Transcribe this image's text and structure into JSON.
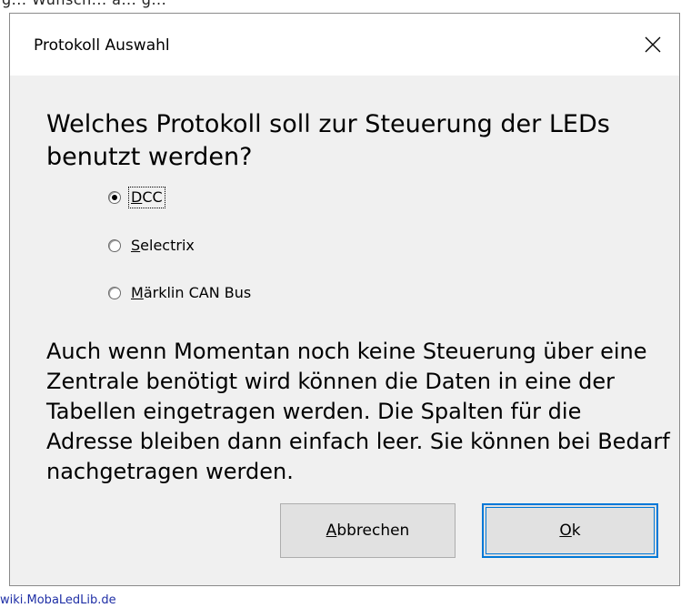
{
  "background": {
    "top_text": "g... Wunsch... a... g...",
    "bottom_link": "wiki.MobaLedLib.de"
  },
  "dialog": {
    "title": "Protokoll Auswahl",
    "close_icon": "close-icon",
    "question": "Welches Protokoll soll zur Steuerung der LEDs benutzt werden?",
    "options": [
      {
        "label_ul": "D",
        "label_rest": "CC",
        "checked": true,
        "focused": true
      },
      {
        "label_ul": "S",
        "label_rest": "electrix",
        "checked": false,
        "focused": false
      },
      {
        "label_ul": "M",
        "label_rest": "ärklin CAN Bus",
        "checked": false,
        "focused": false
      }
    ],
    "info": "Auch wenn Momentan noch keine Steuerung über eine Zentrale benötigt wird können die Daten in eine der Tabellen eingetragen werden. Die Spalten für die Adresse bleiben dann einfach leer. Sie können bei Bedarf nachgetragen werden.",
    "buttons": {
      "cancel_ul": "A",
      "cancel_rest": "bbrechen",
      "ok_ul": "O",
      "ok_rest": "k"
    }
  }
}
